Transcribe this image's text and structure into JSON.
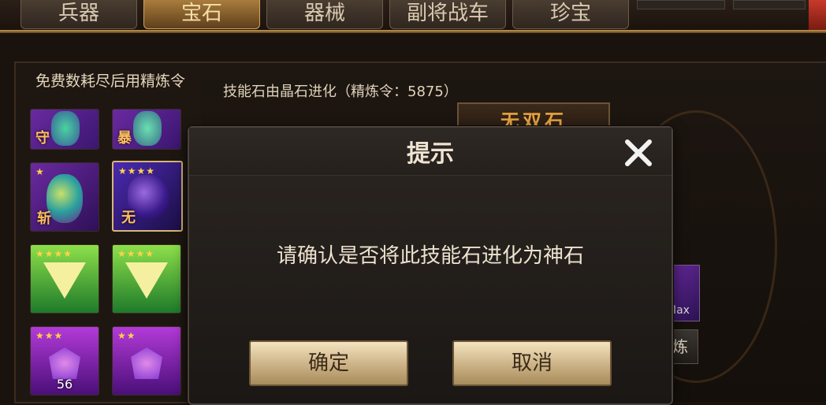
{
  "tabs": [
    {
      "label": "兵器",
      "active": false
    },
    {
      "label": "宝石",
      "active": true
    },
    {
      "label": "器械",
      "active": false
    },
    {
      "label": "副将战车",
      "active": false
    },
    {
      "label": "珍宝",
      "active": false
    }
  ],
  "left_panel": {
    "title": "免费数耗尽后用精炼令",
    "slots": [
      {
        "char": "守",
        "stars": ""
      },
      {
        "char": "暴",
        "stars": ""
      },
      {
        "char": "斩",
        "stars": "★"
      },
      {
        "char": "无",
        "stars": "★★★★",
        "selected": true
      },
      {
        "char": "",
        "stars": "★★★★"
      },
      {
        "char": "",
        "stars": "★★★★"
      },
      {
        "char": "",
        "stars": "★★★",
        "count": "56"
      },
      {
        "char": "",
        "stars": "★★"
      }
    ]
  },
  "right_panel": {
    "info": "技能石由晶石进化（精炼令：5875）",
    "stone_name": "无双石",
    "side_label": "Max",
    "side_button": "炼"
  },
  "dialog": {
    "title": "提示",
    "message": "请确认是否将此技能石进化为神石",
    "confirm": "确定",
    "cancel": "取消"
  },
  "colors": {
    "accent_gold": "#d2a25a",
    "gem_purple": "#7b2fd0",
    "gem_green": "#8de04a"
  }
}
